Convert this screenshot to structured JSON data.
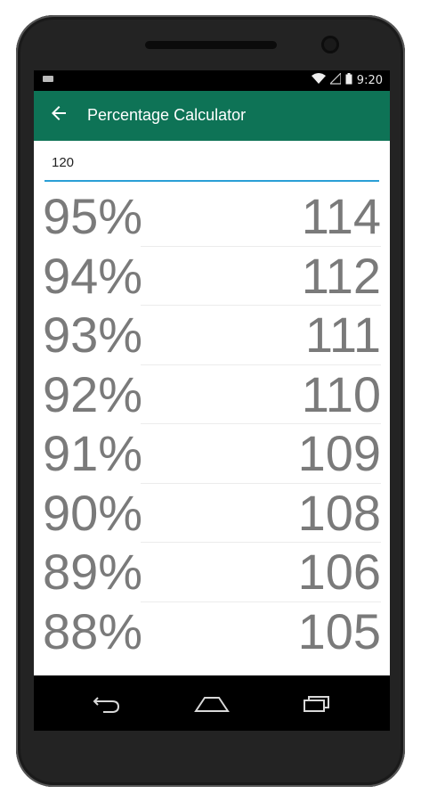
{
  "status": {
    "time": "9:20"
  },
  "appbar": {
    "title": "Percentage Calculator"
  },
  "input": {
    "value": "120"
  },
  "rows": [
    {
      "percent": "95%",
      "value": "114"
    },
    {
      "percent": "94%",
      "value": "112"
    },
    {
      "percent": "93%",
      "value": "111"
    },
    {
      "percent": "92%",
      "value": "110"
    },
    {
      "percent": "91%",
      "value": "109"
    },
    {
      "percent": "90%",
      "value": "108"
    },
    {
      "percent": "89%",
      "value": "106"
    },
    {
      "percent": "88%",
      "value": "105"
    }
  ],
  "colors": {
    "appbar": "#0e7356",
    "input_underline": "#2a9fd6",
    "row_text": "#7a7a7a"
  },
  "icons": [
    "back-arrow-icon",
    "wifi-icon",
    "signal-icon",
    "battery-icon",
    "nav-back-icon",
    "nav-home-icon",
    "nav-recents-icon"
  ]
}
